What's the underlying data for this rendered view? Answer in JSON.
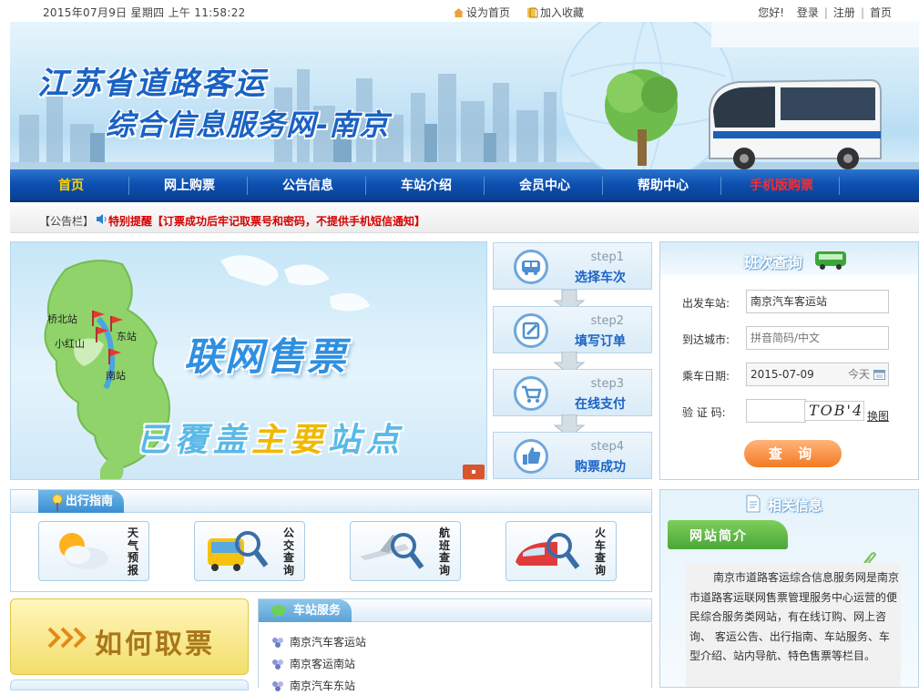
{
  "topbar": {
    "datetime": "2015年07月9日  星期四  上午   11:58:22",
    "set_home": "设为首页",
    "add_favorite": "加入收藏",
    "greeting": "您好!",
    "login": "登录",
    "register": "注册",
    "home": "首页"
  },
  "banner": {
    "title_line1": "江苏省道路客运",
    "title_line2": "综合信息服务网-南京"
  },
  "nav": {
    "items": [
      "首页",
      "网上购票",
      "公告信息",
      "车站介绍",
      "会员中心",
      "帮助中心",
      "手机版购票"
    ],
    "active_color": "#ffd200",
    "mobile_color": "#ff2a2a"
  },
  "notice": {
    "label": "【公告栏】",
    "message": "特别提醒【订票成功后牢记取票号和密码，不提供手机短信通知】"
  },
  "map": {
    "headline": "联网售票",
    "tagline_a": "已覆盖",
    "tagline_b": "主要",
    "tagline_c": "站点",
    "stations": [
      "桥北站",
      "东站",
      "小红山",
      "南站"
    ]
  },
  "steps": [
    {
      "num": "step1",
      "label": "选择车次",
      "icon": "bus-icon"
    },
    {
      "num": "step2",
      "label": "填写订单",
      "icon": "edit-icon"
    },
    {
      "num": "step3",
      "label": "在线支付",
      "icon": "cart-icon"
    },
    {
      "num": "step4",
      "label": "购票成功",
      "icon": "thumbs-up-icon"
    }
  ],
  "query": {
    "title": "班次查询",
    "depart_label": "出发车站:",
    "depart_value": "南京汽车客运站",
    "arrive_label": "到达城市:",
    "arrive_placeholder": "拼音简码/中文",
    "date_label": "乘车日期:",
    "date_value": "2015-07-09",
    "date_hint": "今天",
    "captcha_label": "验 证 码:",
    "captcha_text": "TOB'4",
    "captcha_refresh": "换图",
    "submit": "查  询"
  },
  "guide": {
    "title": "出行指南",
    "items": [
      {
        "label": "天气预报",
        "icon": "weather-icon"
      },
      {
        "label": "公交查询",
        "icon": "bus-search-icon"
      },
      {
        "label": "航班查询",
        "icon": "plane-search-icon"
      },
      {
        "label": "火车查询",
        "icon": "train-search-icon"
      }
    ]
  },
  "howto": {
    "label": "如何取票"
  },
  "station_service": {
    "title": "车站服务",
    "items": [
      "南京汽车客运站",
      "南京客运南站",
      "南京汽车东站"
    ]
  },
  "related": {
    "title": "相关信息",
    "intro_title": "网站简介",
    "intro_text": "南京市道路客运综合信息服务网是南京市道路客运联网售票管理服务中心运营的便民综合服务类网站，有在线订购、网上咨询、 客运公告、出行指南、车站服务、车型介绍、站内导航、特色售票等栏目。"
  }
}
